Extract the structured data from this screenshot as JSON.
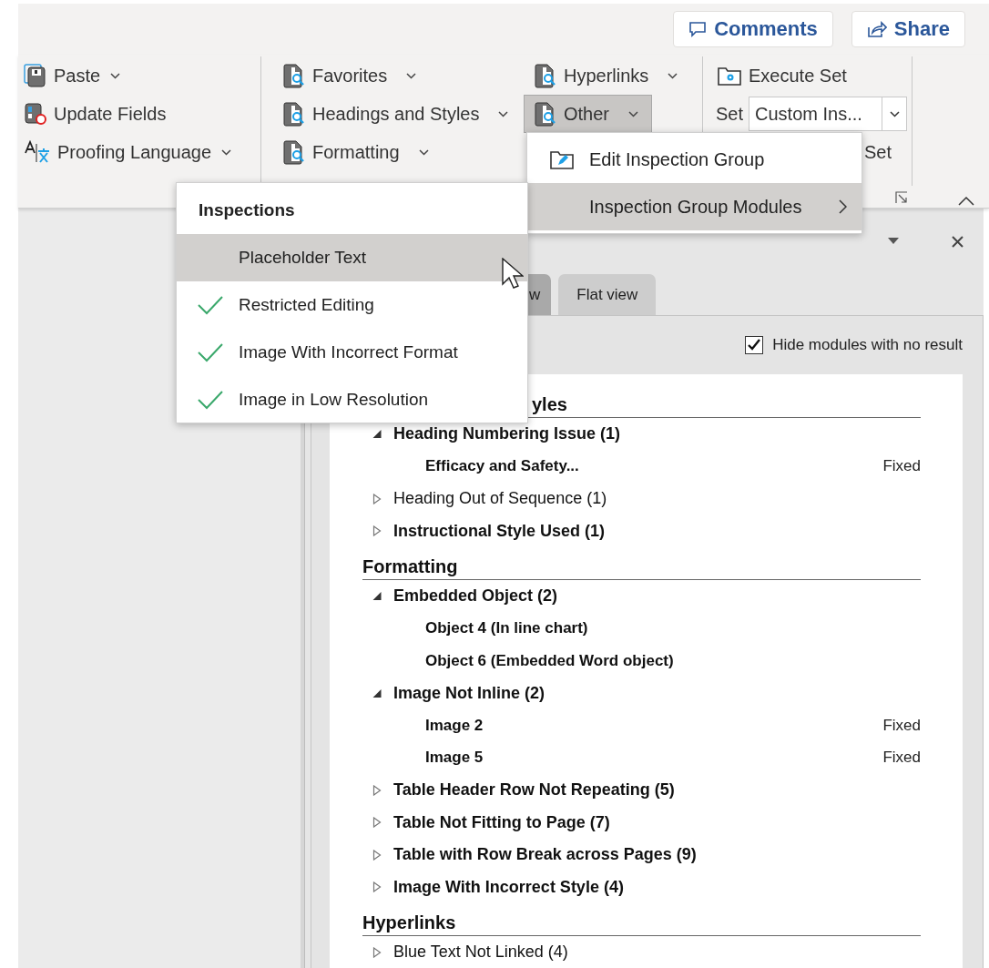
{
  "header_buttons": [
    {
      "label": "Comments",
      "kind": "comments"
    },
    {
      "label": "Share",
      "kind": "share"
    }
  ],
  "ribbon_groups": [
    {
      "commands": [
        {
          "label": "Paste",
          "kind": "paste",
          "dropdown": true,
          "pressed": false
        },
        {
          "label": "Update Fields",
          "kind": "update",
          "dropdown": false,
          "pressed": false
        },
        {
          "label": "Proofing Language",
          "kind": "language",
          "dropdown": true,
          "pressed": false
        }
      ]
    },
    {
      "commands": [
        {
          "label": "Favorites",
          "kind": "inspect",
          "dropdown": true,
          "pressed": false
        },
        {
          "label": "Headings and Styles",
          "kind": "inspect",
          "dropdown": true,
          "pressed": false
        },
        {
          "label": "Formatting",
          "kind": "inspect",
          "dropdown": true,
          "pressed": false
        }
      ]
    },
    {
      "commands": [
        {
          "label": "Hyperlinks",
          "kind": "inspect",
          "dropdown": true,
          "pressed": false
        },
        {
          "label": "Other",
          "kind": "inspect",
          "dropdown": true,
          "pressed": true
        }
      ]
    }
  ],
  "set_group": {
    "execute_label": "Execute Set",
    "set_label": "Set",
    "set_value": "Custom Ins...",
    "partial_label": "Set"
  },
  "panel": {
    "tabs": [
      {
        "label": "w",
        "selected": true
      },
      {
        "label": "Flat view",
        "selected": false
      }
    ],
    "hide_empty": {
      "label": "Hide modules with no result",
      "checked": true
    },
    "sections": [
      {
        "title": "yles",
        "items": [
          {
            "label": "Heading Numbering Issue (1)",
            "bold": true,
            "expanded": true,
            "children": [
              {
                "label": "Efficacy and Safety...",
                "status": "Fixed"
              }
            ]
          },
          {
            "label": "Heading Out of Sequence (1)",
            "bold": false,
            "expanded": false
          },
          {
            "label": "Instructional Style Used (1)",
            "bold": true,
            "expanded": false
          }
        ]
      },
      {
        "title": "Formatting",
        "items": [
          {
            "label": "Embedded Object (2)",
            "bold": true,
            "expanded": true,
            "children": [
              {
                "label": "Object 4 (In line chart)"
              },
              {
                "label": "Object 6 (Embedded Word object)"
              }
            ]
          },
          {
            "label": "Image Not Inline (2)",
            "bold": true,
            "expanded": true,
            "children": [
              {
                "label": "Image 2",
                "status": "Fixed"
              },
              {
                "label": "Image 5",
                "status": "Fixed"
              }
            ]
          },
          {
            "label": "Table Header Row Not Repeating (5)",
            "bold": true,
            "expanded": false
          },
          {
            "label": "Table Not Fitting to Page (7)",
            "bold": true,
            "expanded": false
          },
          {
            "label": "Table with Row Break across Pages (9)",
            "bold": true,
            "expanded": false
          },
          {
            "label": "Image With Incorrect Style (4)",
            "bold": true,
            "expanded": false
          }
        ]
      },
      {
        "title": "Hyperlinks",
        "items": [
          {
            "label": "Blue Text Not Linked (4)",
            "bold": false,
            "expanded": false
          }
        ]
      }
    ]
  },
  "other_menu": {
    "items": [
      {
        "label": "Edit Inspection Group",
        "kind": "edit",
        "submenu": false,
        "selected": false
      },
      {
        "label": "Inspection Group Modules",
        "kind": "plain",
        "submenu": true,
        "selected": true
      }
    ]
  },
  "inspections_menu": {
    "title": "Inspections",
    "items": [
      {
        "label": "Placeholder Text",
        "checked": false,
        "selected": true
      },
      {
        "label": "Restricted Editing",
        "checked": true,
        "selected": false
      },
      {
        "label": "Image With Incorrect Format",
        "checked": true,
        "selected": false
      },
      {
        "label": "Image in Low Resolution",
        "checked": true,
        "selected": false
      }
    ]
  }
}
